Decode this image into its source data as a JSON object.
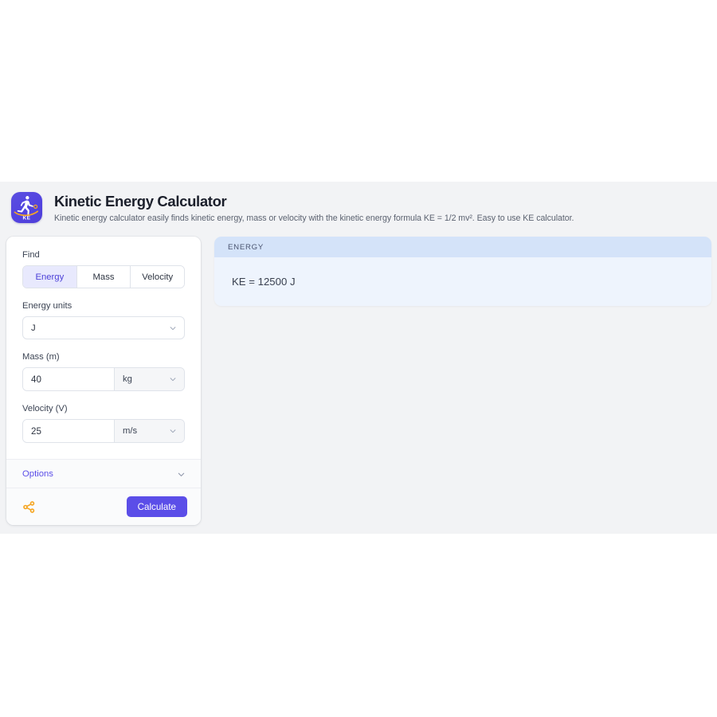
{
  "header": {
    "title": "Kinetic Energy Calculator",
    "subtitle": "Kinetic energy calculator easily finds kinetic energy, mass or velocity with the kinetic energy formula KE = 1/2 mv². Easy to use KE calculator.",
    "logo_text": "KE",
    "logo_icon": "athlete-kicking-ball-icon"
  },
  "calculator": {
    "find": {
      "label": "Find",
      "tabs": [
        {
          "label": "Energy",
          "active": true
        },
        {
          "label": "Mass",
          "active": false
        },
        {
          "label": "Velocity",
          "active": false
        }
      ]
    },
    "energy_units": {
      "label": "Energy units",
      "value": "J"
    },
    "mass": {
      "label": "Mass (m)",
      "value": "40",
      "unit": "kg"
    },
    "velocity": {
      "label": "Velocity (V)",
      "value": "25",
      "unit": "m/s"
    },
    "options": {
      "label": "Options",
      "icon": "chevron-down-icon"
    },
    "footer": {
      "share_icon": "share-icon",
      "calculate_label": "Calculate"
    }
  },
  "result": {
    "header_label": "ENERGY",
    "value": "KE = 12500 J"
  },
  "colors": {
    "accent_purple": "#5b4ee8",
    "accent_purple_soft": "#e8e9fd",
    "share_orange": "#f5a623",
    "result_header_blue": "#d4e3f9",
    "result_body_blue": "#eef4fd",
    "app_background": "#f2f3f5"
  }
}
